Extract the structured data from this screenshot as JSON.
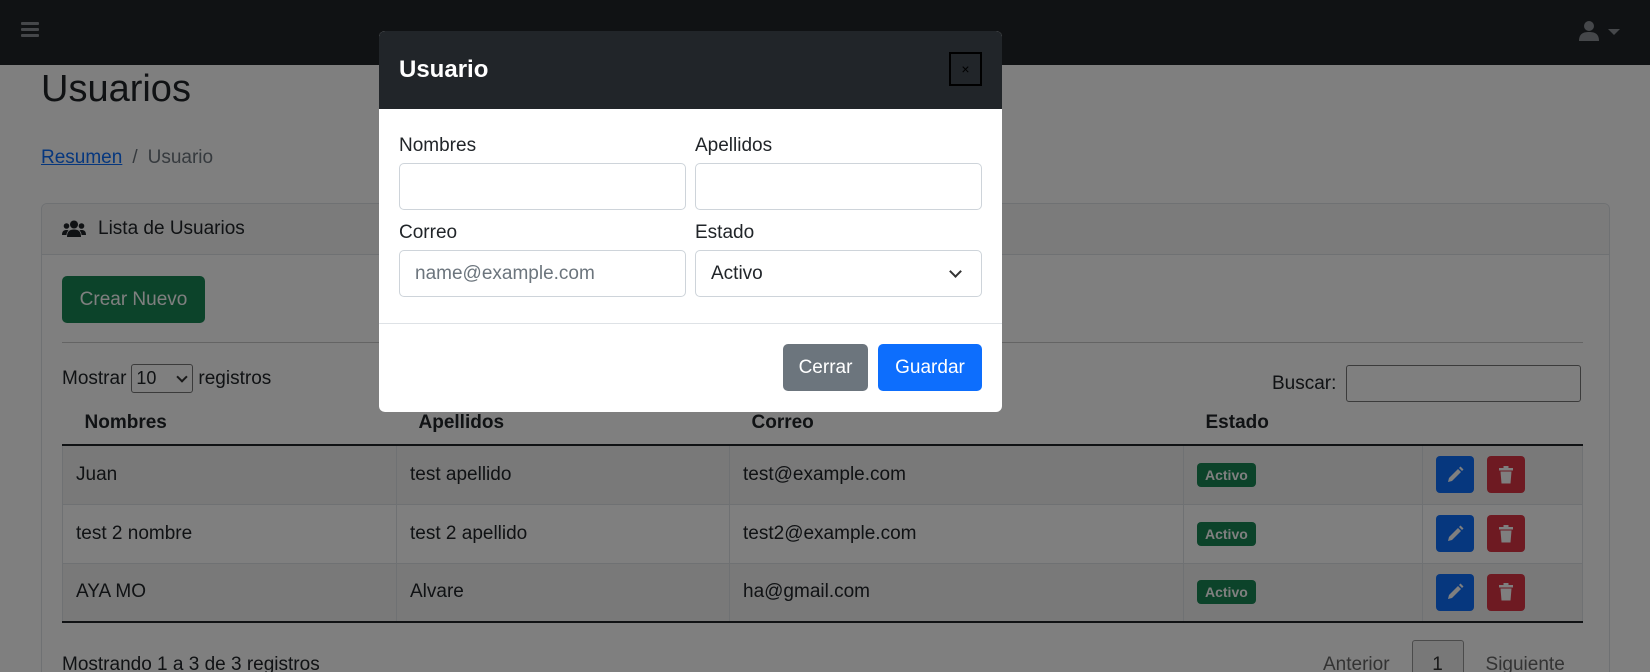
{
  "topnav": {
    "menu_icon": "hamburger-icon",
    "user_icon": "user-icon"
  },
  "page": {
    "title": "Usuarios",
    "breadcrumb": {
      "home": "Resumen",
      "separator": "/",
      "current": "Usuario"
    }
  },
  "card": {
    "header": "Lista de Usuarios",
    "header_icon": "users-icon",
    "create_label": "Crear Nuevo",
    "length": {
      "prefix": "Mostrar",
      "value": "10",
      "suffix": "registros"
    },
    "search_label": "Buscar:",
    "columns": [
      "Nombres",
      "Apellidos",
      "Correo",
      "Estado"
    ],
    "rows": [
      {
        "nombres": "Juan",
        "apellidos": "test apellido",
        "correo": "test@example.com",
        "estado": "Activo"
      },
      {
        "nombres": "test 2 nombre",
        "apellidos": "test 2 apellido",
        "correo": "test2@example.com",
        "estado": "Activo"
      },
      {
        "nombres": "AYA MO",
        "apellidos": "Alvare",
        "correo": "ha@gmail.com",
        "estado": "Activo"
      }
    ],
    "info": "Mostrando 1 a 3 de 3 registros",
    "pager": {
      "prev": "Anterior",
      "current": "1",
      "next": "Siguiente"
    }
  },
  "modal": {
    "title": "Usuario",
    "close_symbol": "×",
    "fields": {
      "nombres_label": "Nombres",
      "nombres_value": "",
      "apellidos_label": "Apellidos",
      "apellidos_value": "",
      "correo_label": "Correo",
      "correo_placeholder": "name@example.com",
      "estado_label": "Estado",
      "estado_value": "Activo"
    },
    "cancel_label": "Cerrar",
    "save_label": "Guardar"
  },
  "colors": {
    "navbar": "#212529",
    "primary": "#0d6efd",
    "success": "#198754",
    "danger": "#dc3545",
    "secondary": "#6c757d"
  }
}
